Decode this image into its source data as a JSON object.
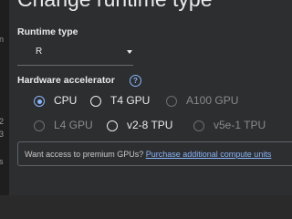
{
  "dialog": {
    "title": "Change runtime type"
  },
  "background": {
    "fragments": [
      "n",
      "2",
      "3",
      "s"
    ]
  },
  "runtime": {
    "label": "Runtime type",
    "selected": "R",
    "options": [
      "R"
    ]
  },
  "accelerator": {
    "label": "Hardware accelerator",
    "help_icon": "help-circle-icon",
    "options": [
      {
        "label": "CPU",
        "checked": true,
        "disabled": false
      },
      {
        "label": "T4 GPU",
        "checked": false,
        "disabled": false
      },
      {
        "label": "A100 GPU",
        "checked": false,
        "disabled": true
      },
      {
        "label": "L4 GPU",
        "checked": false,
        "disabled": true
      },
      {
        "label": "v2-8 TPU",
        "checked": false,
        "disabled": false
      },
      {
        "label": "v5e-1 TPU",
        "checked": false,
        "disabled": true
      }
    ]
  },
  "notice": {
    "text": "Want access to premium GPUs?",
    "link": "Purchase additional compute units"
  },
  "colors": {
    "accent": "#8ab4f8",
    "dialog_bg": "#2d2e30",
    "text": "#e8eaed",
    "disabled": "#8a8a8a"
  }
}
